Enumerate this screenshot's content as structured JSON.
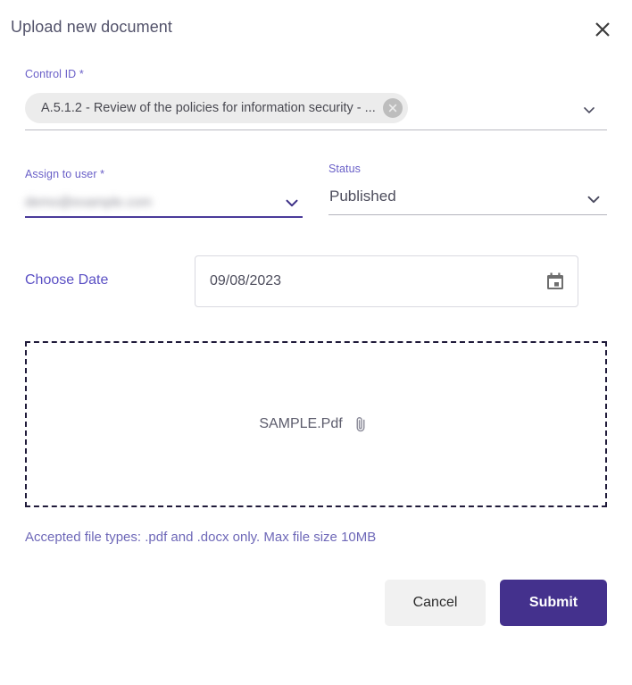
{
  "dialog": {
    "title": "Upload new document",
    "close_icon": "close-icon"
  },
  "control_id": {
    "label": "Control ID *",
    "chip_value": "A.5.1.2 - Review of the policies for information security - ...",
    "chip_remove_icon": "circle-close-icon",
    "dropdown_icon": "chevron-down-icon"
  },
  "assign_to_user": {
    "label": "Assign to user *",
    "value": "demo@example.com",
    "dropdown_icon": "chevron-down-icon"
  },
  "status": {
    "label": "Status",
    "value": "Published",
    "dropdown_icon": "chevron-down-icon"
  },
  "choose_date": {
    "label": "Choose Date",
    "value": "09/08/2023",
    "calendar_icon": "calendar-icon"
  },
  "dropzone": {
    "file_name": "SAMPLE.Pdf",
    "attach_icon": "paperclip-icon"
  },
  "hint": "Accepted file types: .pdf and .docx only. Max file size 10MB",
  "footer": {
    "cancel_label": "Cancel",
    "submit_label": "Submit"
  },
  "colors": {
    "accent_purple": "#44318d",
    "label_purple": "#6a60c8",
    "hint_purple": "#6e68b8",
    "cancel_bg": "#f1f1f1",
    "chip_bg": "#ececec",
    "dropzone_border": "#201b3a"
  }
}
